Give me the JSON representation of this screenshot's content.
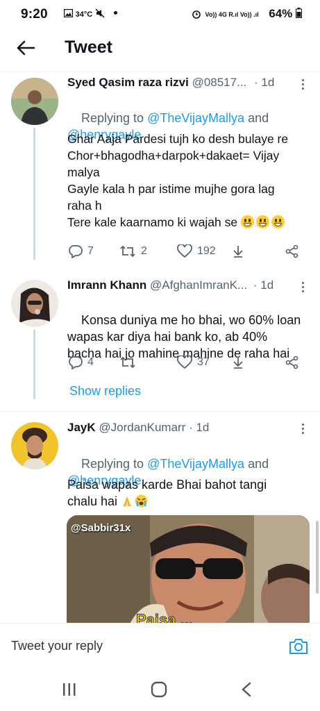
{
  "status_bar": {
    "time": "9:20",
    "temperature": "34°C",
    "network": "Vo)) 4G R.ıl Vo)) .ıl",
    "battery": "64%"
  },
  "header": {
    "title": "Tweet"
  },
  "tweets": [
    {
      "name": "Syed Qasim raza rizvi",
      "handle": "@08517...",
      "time": "· 1d",
      "replying_prefix": "Replying to ",
      "replying_users": [
        "@TheVijayMallya",
        "and",
        "@henrygayle"
      ],
      "text": "Ghar Aaja Pardesi tujh ko desh bulaye re\nChor+bhagodha+darpok+dakaet= Vijay\nmalya\nGayle kala h par istime mujhe gora lag\nraha h\nTere kale kaarnamo ki wajah se ",
      "replies": "7",
      "retweets": "2",
      "likes": "192"
    },
    {
      "name": "Imrann Khann",
      "handle": "@AfghanImranK...",
      "time": "· 1d",
      "text": "Konsa duniya me ho bhai, wo 60% loan\nwapas kar diya hai bank ko, ab 40%\nbacha hai jo mahine mahine de raha hai",
      "replies": "4",
      "retweets": "",
      "likes": "37",
      "show_replies": "Show replies"
    },
    {
      "name": "JayK",
      "handle": "@JordanKumarr",
      "time": "· 1d",
      "replying_prefix": "Replying to ",
      "replying_users": [
        "@TheVijayMallya",
        "and",
        "@henrygayle"
      ],
      "text": "Paisa wapas karde Bhai bahot tangi\nchalu hai ",
      "media_watermark": "@Sabbir31x"
    }
  ],
  "reply_bar": {
    "placeholder": "Tweet your reply"
  },
  "colors": {
    "accent": "#1d9bf0",
    "secondary_text": "#536471"
  }
}
